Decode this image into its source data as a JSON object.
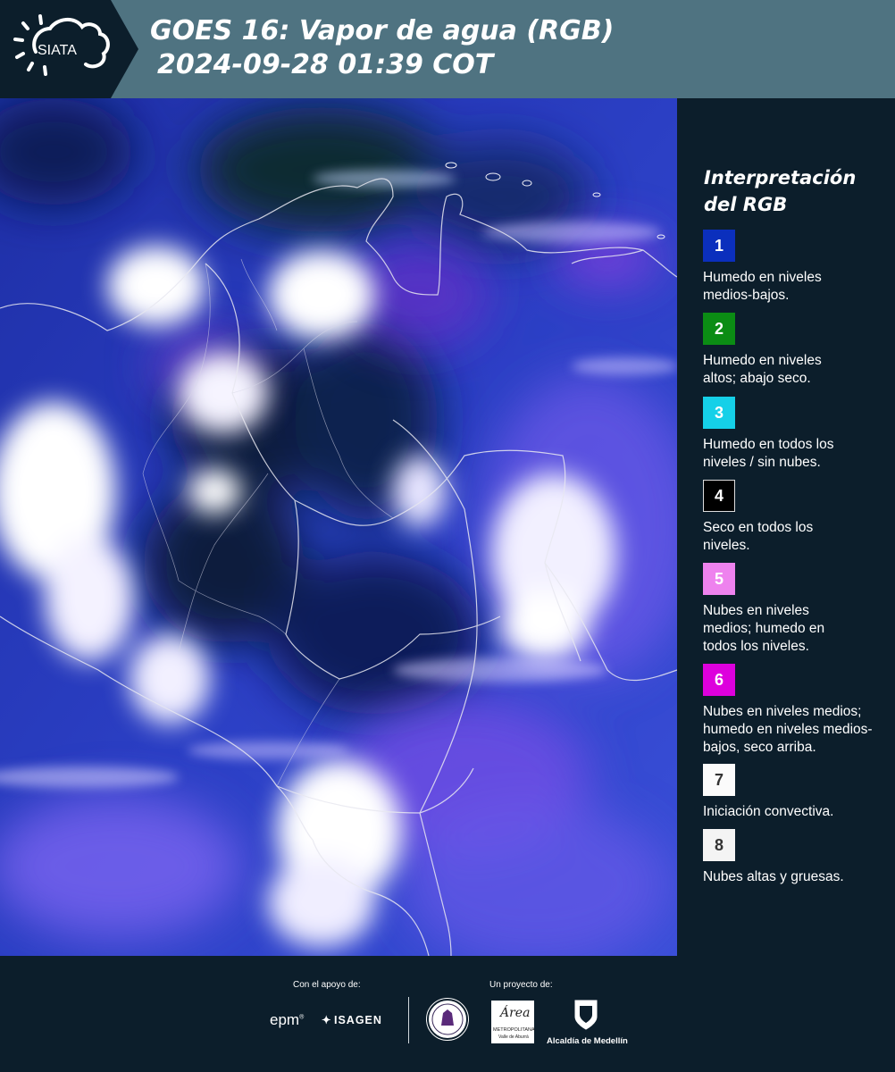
{
  "header": {
    "logo_text": "SIATA",
    "title_line1": "GOES 16: Vapor de agua (RGB)",
    "title_line2": "2024-09-28 01:39 COT"
  },
  "legend": {
    "title_line1": "Interpretación",
    "title_line2": "del RGB",
    "items": [
      {
        "number": "1",
        "color": "#0b2fbd",
        "text": "Humedo en niveles medios-bajos."
      },
      {
        "number": "2",
        "color": "#0b8c14",
        "text": "Humedo en niveles altos; abajo seco."
      },
      {
        "number": "3",
        "color": "#15d0e8",
        "text": "Humedo en todos los niveles / sin nubes."
      },
      {
        "number": "4",
        "color": "#000000",
        "text": "Seco en todos los niveles."
      },
      {
        "number": "5",
        "color": "#ee82ee",
        "text": "Nubes en niveles medios; humedo en todos los niveles."
      },
      {
        "number": "6",
        "color": "#dd00dd",
        "text": "Nubes en niveles medios; humedo en niveles medios-bajos, seco arriba."
      },
      {
        "number": "7",
        "color": "#fbfbfb",
        "text": "Iniciación convectiva."
      },
      {
        "number": "8",
        "color": "#f4f4f4",
        "text": "Nubes altas y gruesas."
      }
    ]
  },
  "footer": {
    "support_label": "Con el apoyo de:",
    "project_label": "Un proyecto de:",
    "epm": "epm",
    "isagen": "ISAGEN",
    "area_name": "Área",
    "area_sub1": "METROPOLITANA",
    "area_sub2": "Valle de Aburrá",
    "alcaldia": "Alcaldía de Medellín"
  }
}
